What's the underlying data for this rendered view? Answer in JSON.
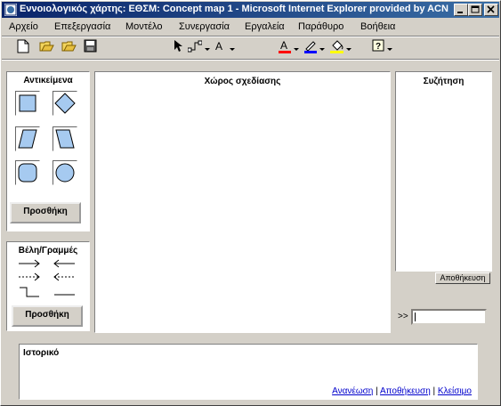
{
  "window": {
    "title": "Εννοιολογικός χάρτης: ΕΘΣΜ: Concept map 1 - Microsoft Internet Explorer provided by ACN",
    "controls": [
      "minimize",
      "maximize",
      "close"
    ]
  },
  "menu": {
    "items": [
      "Αρχείο",
      "Επεξεργασία",
      "Μοντέλο",
      "Συνεργασία",
      "Εργαλεία",
      "Παράθυρο",
      "Βοήθεια"
    ]
  },
  "toolbar": {
    "text_tool_label": "A",
    "icons": [
      "new-document-icon",
      "open-folder-icon",
      "open-folder-icon",
      "save-disk-icon",
      "pointer-icon",
      "connector-icon",
      "text-icon",
      "font-color-icon",
      "line-color-icon",
      "fill-color-icon",
      "help-icon"
    ],
    "colors": {
      "font": "#ff0000",
      "line": "#0000ff",
      "fill": "#ffff00"
    }
  },
  "objects_panel": {
    "title": "Αντικείμενα",
    "shapes": [
      "rectangle",
      "diamond",
      "parallelogram",
      "trapezoid",
      "rounded-square",
      "circle"
    ],
    "add_button": "Προσθήκη"
  },
  "arrows_panel": {
    "title": "Βέλη/Γραμμές",
    "lines": [
      "arrow-right-solid",
      "arrow-left-solid",
      "arrow-right-dashed",
      "arrow-left-dashed",
      "elbow-line",
      "plain-line"
    ],
    "add_button": "Προσθήκη"
  },
  "canvas": {
    "title": "Χώρος σχεδίασης"
  },
  "discussion": {
    "title": "Συζήτηση",
    "save_button": "Αποθήκευση",
    "prompt": ">>",
    "input_value": ""
  },
  "history": {
    "title": "Ιστορικό",
    "links": [
      "Ανανέωση",
      "Αποθήκευση",
      "Κλείσιμο"
    ]
  },
  "colors": {
    "titlebar_start": "#0a246a",
    "titlebar_end": "#3a6ea5",
    "shape_fill": "#a6caf0",
    "link": "#0000cc",
    "chrome": "#d4d0c8"
  }
}
